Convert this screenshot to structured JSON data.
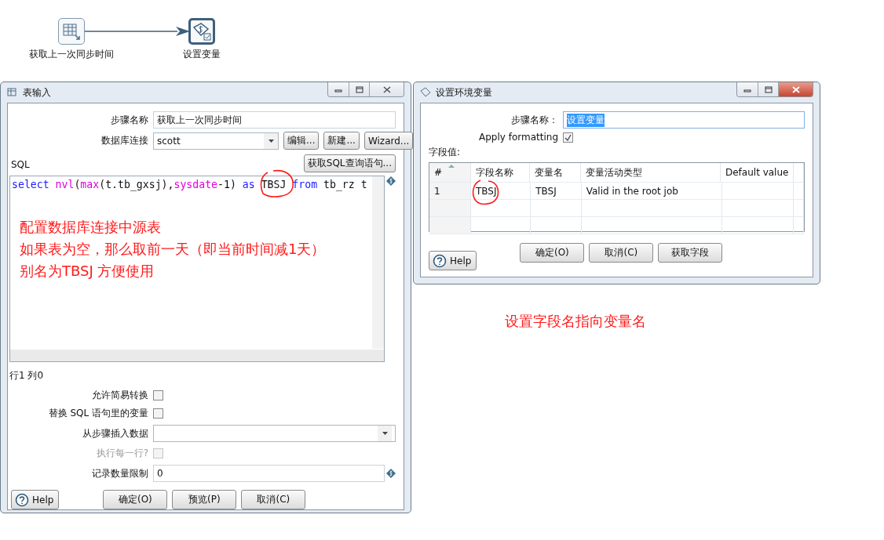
{
  "canvas": {
    "steps": [
      {
        "label": "获取上一次同步时间",
        "kind": "table-input"
      },
      {
        "label": "设置变量",
        "kind": "set-variable"
      }
    ]
  },
  "table_input_dialog": {
    "title": "表输入",
    "step_name_label": "步骤名称",
    "step_name": "获取上一次同步时间",
    "connection_label": "数据库连接",
    "connection": "scott",
    "connection_buttons": [
      "编辑...",
      "新建...",
      "Wizard..."
    ],
    "sql_label": "SQL",
    "get_sql_button": "获取SQL查询语句...",
    "sql_tokens": [
      {
        "text": "select",
        "kind": "keyword"
      },
      {
        "text": " nvl",
        "kind": "function"
      },
      {
        "text": "(",
        "kind": "plain"
      },
      {
        "text": "max",
        "kind": "function"
      },
      {
        "text": "(t.tb_gxsj),",
        "kind": "plain"
      },
      {
        "text": "sysdate",
        "kind": "function"
      },
      {
        "text": "-1) ",
        "kind": "plain"
      },
      {
        "text": "as",
        "kind": "keyword"
      },
      {
        "text": " TBSJ ",
        "kind": "plain"
      },
      {
        "text": "from",
        "kind": "keyword"
      },
      {
        "text": " tb_rz t",
        "kind": "plain"
      }
    ],
    "annotation": [
      "配置数据库连接中源表",
      "如果表为空，那么取前一天（即当前时间减1天）",
      "别名为TBSJ 方便使用"
    ],
    "cursor_position": "行1 列0",
    "fields": [
      {
        "kind": "checkbox",
        "label": "允许简易转换",
        "checked": false,
        "disabled": false
      },
      {
        "kind": "checkbox",
        "label": "替换 SQL 语句里的变量",
        "checked": false,
        "disabled": false
      },
      {
        "kind": "dropdown",
        "label": "从步骤插入数据"
      },
      {
        "kind": "checkbox",
        "label": "执行每一行?",
        "checked": false,
        "disabled": true
      },
      {
        "kind": "text",
        "label": "记录数量限制",
        "value": "0"
      }
    ],
    "help": "Help",
    "buttons": [
      "确定(O)",
      "预览(P)",
      "取消(C)"
    ]
  },
  "set_variable_dialog": {
    "title": "设置环境变量",
    "step_name_label": "步骤名称：",
    "step_name": "设置变量",
    "step_name_text_selected": true,
    "apply_formatting": {
      "label": "Apply formatting",
      "checked": true
    },
    "fields_label": "字段值:",
    "table": {
      "columns": [
        "#",
        "字段名称",
        "变量名",
        "变量活动类型",
        "Default value"
      ],
      "rows": [
        [
          "1",
          "TBSJ",
          "TBSJ",
          "Valid in the root job"
        ]
      ]
    },
    "help": "Help",
    "buttons": [
      "确定(O)",
      "取消(C)",
      "获取字段"
    ]
  },
  "annotation": "设置字段名指向变量名"
}
